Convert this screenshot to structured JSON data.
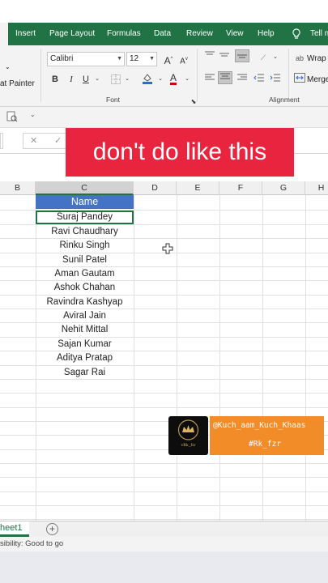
{
  "ribbon_tabs": [
    "Insert",
    "Page Layout",
    "Formulas",
    "Data",
    "Review",
    "View",
    "Help",
    "Tell m"
  ],
  "ribbon": {
    "format_painter": "at Painter",
    "font_name": "Calibri",
    "font_size": "12",
    "grow_font": "A",
    "shrink_font": "A",
    "bold": "B",
    "italic": "I",
    "underline": "U",
    "font_color": "A",
    "wrap_text": "Wrap",
    "merge": "Merge",
    "font_group_label": "Font",
    "alignment_group_label": "Alignment"
  },
  "formula_bar": {
    "cancel": "✕",
    "enter": "✓"
  },
  "banner_text": "don't do like this",
  "columns": [
    "B",
    "C",
    "D",
    "E",
    "F",
    "G",
    "H"
  ],
  "sheet": {
    "header": "Name",
    "names": [
      "Suraj Pandey",
      "Ravi Chaudhary",
      "Rinku Singh",
      "Sunil Patel",
      "Aman Gautam",
      "Ashok Chahan",
      "Ravindra Kashyap",
      "Aviral Jain",
      "Nehit Mittal",
      "Sajan Kumar",
      "Aditya Pratap",
      "Sagar Rai"
    ]
  },
  "watermark": {
    "handle": "@Kuch_aam_Kuch_Khaas",
    "tag": "#Rk_fzr",
    "logo_text": "vRk_fzr"
  },
  "sheet_tab": "heet1",
  "add_sheet": "+",
  "status": "sibility: Good to go",
  "colors": {
    "excel_green": "#217346",
    "header_blue": "#4472c4",
    "banner_red": "#e8243f",
    "watermark_orange": "#f28c28"
  }
}
